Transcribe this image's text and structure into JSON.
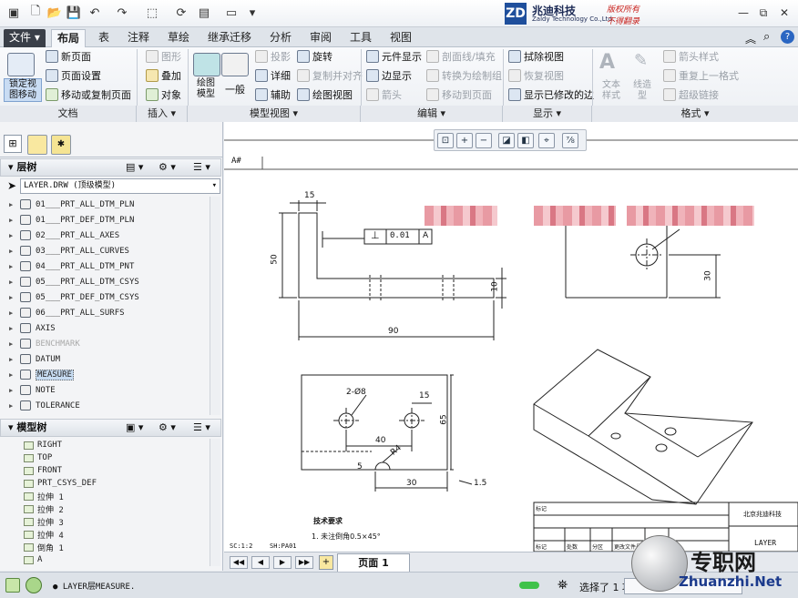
{
  "window": {
    "brand_cn": "兆迪科技",
    "brand_en": "Zaldy Technology Co.,Ltd.",
    "brand_logo": "ZD",
    "rights_1": "版权所有",
    "rights_2": "不得翻录",
    "win_min": "—",
    "win_restore": "⧉",
    "win_close": "✕"
  },
  "tabs": [
    "文件",
    "布局",
    "表",
    "注释",
    "草绘",
    "继承迁移",
    "分析",
    "审阅",
    "工具",
    "视图"
  ],
  "ribbon": {
    "doc_group": {
      "lock_view": "锁定视\n图移动",
      "new_page": "新页面",
      "page_setup": "页面设置",
      "move_copy_page": "移动或复制页面",
      "label": "文档"
    },
    "insert_group": {
      "graphic": "图形",
      "overlay": "叠加",
      "object": "对象",
      "label": "插入"
    },
    "model_view_group": {
      "drawing_model": "绘图\n模型",
      "general": "一般",
      "projection": "投影",
      "detail": "详细",
      "auxiliary": "辅助",
      "rotate": "旋转",
      "copy_align": "复制并对齐",
      "drawing_view": "绘图视图",
      "label": "模型视图"
    },
    "edit_group": {
      "element_display": "元件显示",
      "edge_display": "边显示",
      "arrow": "箭头",
      "section_line_fill": "剖面线/填充",
      "convert_to_draw_group": "转换为绘制组",
      "move_to_page": "移动到页面",
      "label": "编辑"
    },
    "display_group": {
      "erase_view": "拭除视图",
      "restore_view": "恢复视图",
      "show_modified_edges": "显示已修改的边",
      "label": "显示"
    },
    "format_group": {
      "text_style": "文本\n样式",
      "line_style": "线造\n型",
      "arrow_style": "箭头样式",
      "repeat_last_format": "重复上一格式",
      "hyperlink": "超级链接",
      "label": "格式"
    }
  },
  "layer_tree": {
    "title": "层树",
    "dropdown": "LAYER.DRW (顶级模型)",
    "items": [
      {
        "label": "01___PRT_ALL_DTM_PLN",
        "dim": false
      },
      {
        "label": "01___PRT_DEF_DTM_PLN",
        "dim": false
      },
      {
        "label": "02___PRT_ALL_AXES",
        "dim": false
      },
      {
        "label": "03___PRT_ALL_CURVES",
        "dim": false
      },
      {
        "label": "04___PRT_ALL_DTM_PNT",
        "dim": false
      },
      {
        "label": "05___PRT_ALL_DTM_CSYS",
        "dim": false
      },
      {
        "label": "05___PRT_DEF_DTM_CSYS",
        "dim": false
      },
      {
        "label": "06___PRT_ALL_SURFS",
        "dim": false
      },
      {
        "label": "AXIS",
        "dim": false
      },
      {
        "label": "BENCHMARK",
        "dim": true
      },
      {
        "label": "DATUM",
        "dim": false
      },
      {
        "label": "MEASURE",
        "dim": false,
        "selected": true
      },
      {
        "label": "NOTE",
        "dim": false
      },
      {
        "label": "TOLERANCE",
        "dim": false
      }
    ]
  },
  "model_tree": {
    "title": "模型树",
    "items": [
      "RIGHT",
      "TOP",
      "FRONT",
      "PRT_CSYS_DEF",
      "拉伸 1",
      "拉伸 2",
      "拉伸 3",
      "拉伸 4",
      "倒角 1",
      "A"
    ]
  },
  "drawing": {
    "sheet_tab": "A#",
    "dim_15_top": "15",
    "dim_50": "50",
    "dim_90": "90",
    "dim_10": "10",
    "gtol_symbol": "⊥",
    "gtol_value": "0.01",
    "gtol_datum": "A",
    "dim_30_right": "30",
    "hole_note": "2-Ø8",
    "dim_15_plan": "15",
    "dim_65": "65",
    "dim_40": "40",
    "dim_r4": "R4",
    "dim_5": "5",
    "dim_30_plan": "30",
    "dim_1_5": "1.5",
    "tech_req": "技术要求",
    "chamfer_note": "1. 未注倒角0.5×45°",
    "scale_note": "SC:1:2",
    "sheet_note": "SH:PA01",
    "title_company": "北京兆迪科技",
    "title_layer": "LAYER",
    "title_cells": [
      "标记",
      "处数",
      "分区",
      "更改文件号",
      "签名",
      "年月日"
    ],
    "tb_mark": "标记"
  },
  "page_nav": {
    "page_label": "页面 1"
  },
  "status": {
    "message": "LAYER层MEASURE.",
    "selected": "选择了 1 项"
  },
  "watermark": {
    "brand": "专职网",
    "url": "Zhuanzhi.Net"
  }
}
